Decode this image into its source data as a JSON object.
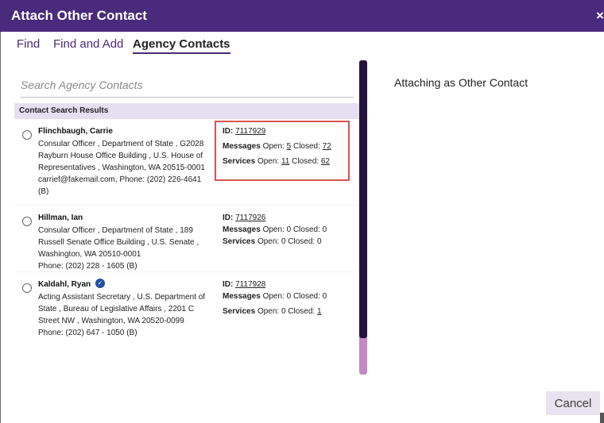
{
  "dialog": {
    "title": "Attach Other Contact",
    "close_glyph": "×"
  },
  "tabs": [
    {
      "label": "Find",
      "active": false
    },
    {
      "label": "Find and Add",
      "active": false
    },
    {
      "label": "Agency Contacts",
      "active": true
    }
  ],
  "search": {
    "placeholder": "Search Agency Contacts",
    "value": ""
  },
  "results": {
    "header": "Contact Search Results",
    "contacts": [
      {
        "name": "Flinchbaugh, Carrie",
        "verified": false,
        "lines": [
          "Consular Officer , Department of State , G2028",
          "Rayburn House Office Building , U.S. House of",
          "Representatives , Washington, WA 20515-0001",
          "carrief@fakemail.com, Phone: (202) 226-4641",
          "(B)"
        ],
        "id_label": "ID:",
        "id": "7117929",
        "messages_label": "Messages",
        "messages_open_label": "Open:",
        "messages_open": "5",
        "messages_closed_label": "Closed:",
        "messages_closed": "72",
        "services_label": "Services",
        "services_open_label": "Open:",
        "services_open": "11",
        "services_closed_label": "Closed:",
        "services_closed": "62",
        "highlighted": true
      },
      {
        "name": "Hillman, Ian",
        "verified": false,
        "lines": [
          "Consular Officer , Department of State , 189",
          "Russell Senate Office Building , U.S. Senate ,",
          "Washington, WA 20510-0001",
          "Phone: (202) 228 - 1605 (B)"
        ],
        "id_label": "ID:",
        "id": "7117926",
        "messages_label": "Messages",
        "messages_text": "Open: 0 Closed: 0",
        "services_label": "Services",
        "services_text": "Open: 0 Closed: 0"
      },
      {
        "name": "Kaldahl, Ryan",
        "verified": true,
        "verified_icon": "verified-badge-icon",
        "lines": [
          "Acting Assistant Secretary , U.S. Department of",
          "State , Bureau of Legislative Affairs , 2201 C",
          "Street NW , Washington, WA 20520-0099",
          "Phone: (202) 647 - 1050 (B)"
        ],
        "id_label": "ID:",
        "id": "7117928",
        "messages_label": "Messages",
        "messages_text": "Open: 0 Closed: 0",
        "services_label": "Services",
        "services_open_text": "Open: 0 Closed:",
        "services_closed": "1"
      }
    ]
  },
  "right_panel": {
    "label": "Attaching as Other Contact"
  },
  "footer": {
    "cancel_label": "Cancel"
  },
  "colors": {
    "title_bar": "#4a2a7c",
    "results_header_bg": "#e6dff2",
    "highlight_box": "#d9534f",
    "scroll_thumb": "#26133e",
    "scroll_track": "#c488c4",
    "cancel_bg": "#e8e3ef"
  }
}
